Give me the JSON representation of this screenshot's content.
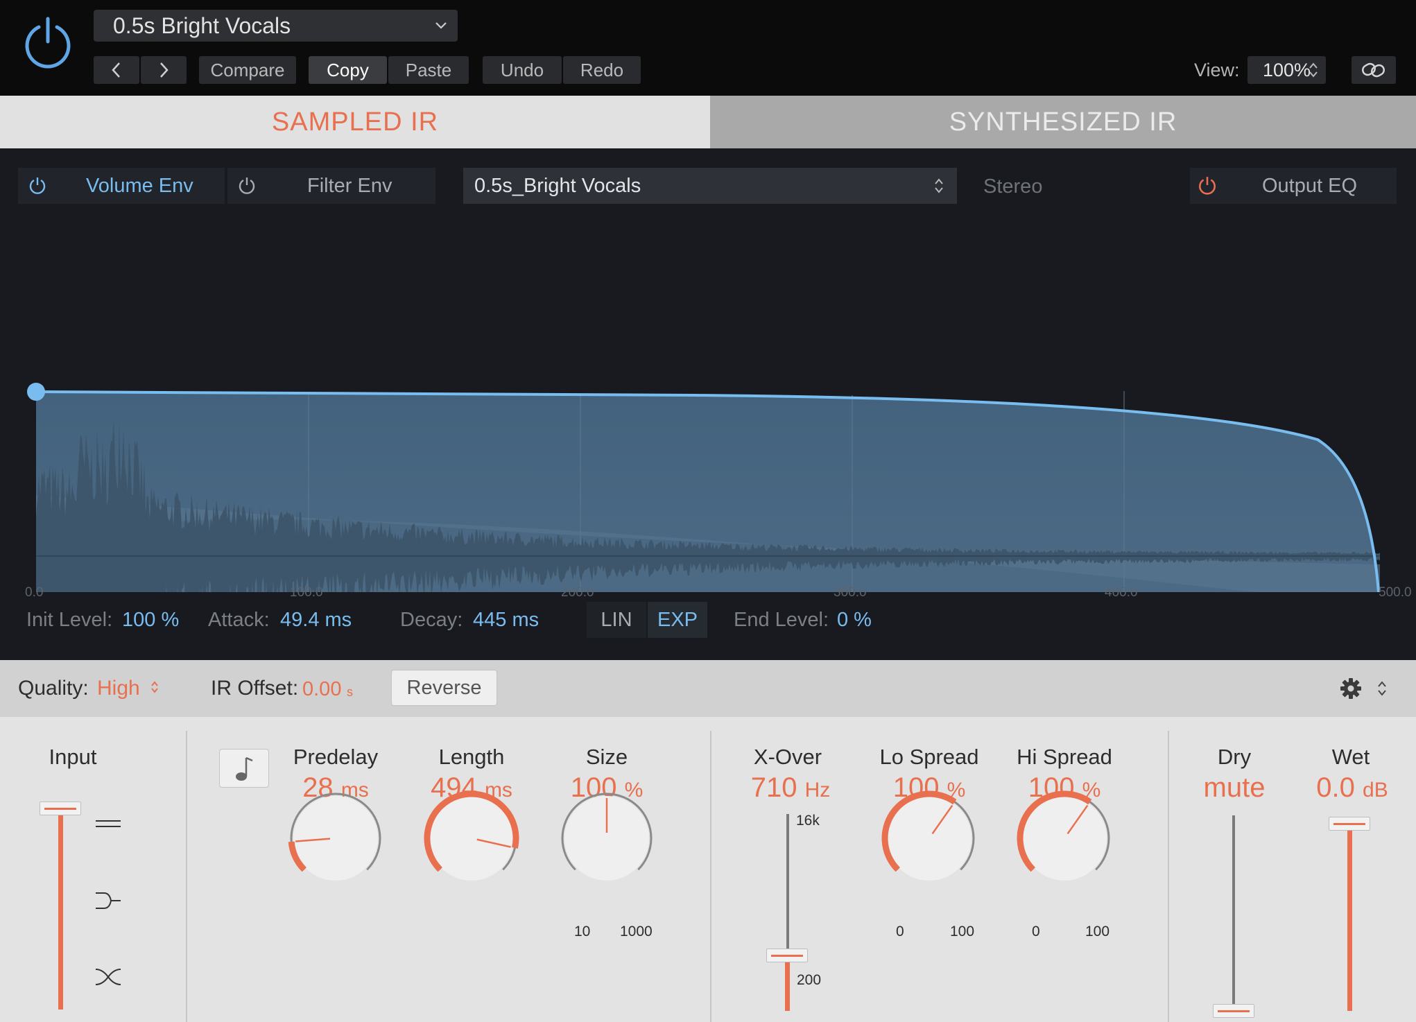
{
  "header": {
    "preset_name": "0.5s Bright Vocals",
    "prev_label": "‹",
    "next_label": "›",
    "compare_label": "Compare",
    "copy_label": "Copy",
    "paste_label": "Paste",
    "undo_label": "Undo",
    "redo_label": "Redo",
    "view_label": "View:",
    "view_value": "100%"
  },
  "tabs": {
    "sampled": "SAMPLED IR",
    "synthesized": "SYNTHESIZED IR"
  },
  "editor": {
    "volume_env": "Volume Env",
    "filter_env": "Filter Env",
    "ir_file": "0.5s_Bright Vocals",
    "stereo": "Stereo",
    "output_eq": "Output EQ",
    "ticks": [
      "0.0",
      "100.0",
      "200.0",
      "300.0",
      "400.0",
      "500.0"
    ],
    "init_level_label": "Init Level:",
    "init_level_value": "100 %",
    "attack_label": "Attack:",
    "attack_value": "49.4 ms",
    "decay_label": "Decay:",
    "decay_value": "445 ms",
    "lin": "LIN",
    "exp": "EXP",
    "end_level_label": "End Level:",
    "end_level_value": "0 %"
  },
  "strip": {
    "quality_label": "Quality:",
    "quality_value": "High",
    "ir_offset_label": "IR Offset:",
    "ir_offset_value": "0.00",
    "ir_offset_unit": "s",
    "reverse": "Reverse"
  },
  "controls": {
    "input": {
      "label": "Input"
    },
    "predelay": {
      "label": "Predelay",
      "value": "28",
      "unit": "ms",
      "level": 0.15
    },
    "length": {
      "label": "Length",
      "value": "494",
      "unit": "ms",
      "level": 0.88
    },
    "size": {
      "label": "Size",
      "value": "100",
      "unit": "%",
      "min": "10",
      "max": "1000",
      "level": 0.5
    },
    "xover": {
      "label": "X-Over",
      "value": "710",
      "unit": "Hz",
      "top": "16k",
      "bottom": "200",
      "level": 0.28
    },
    "lo_spread": {
      "label": "Lo Spread",
      "value": "100",
      "unit": "%",
      "min": "0",
      "max": "100",
      "level": 0.63
    },
    "hi_spread": {
      "label": "Hi Spread",
      "value": "100",
      "unit": "%",
      "min": "0",
      "max": "100",
      "level": 0.63
    },
    "dry": {
      "label": "Dry",
      "value": "mute",
      "level": 0.0
    },
    "wet": {
      "label": "Wet",
      "value": "0.0",
      "unit": "dB",
      "level": 0.95
    }
  },
  "colors": {
    "accent": "#e8704f",
    "blue": "#79bdf0",
    "waveform": "#4e677e"
  }
}
